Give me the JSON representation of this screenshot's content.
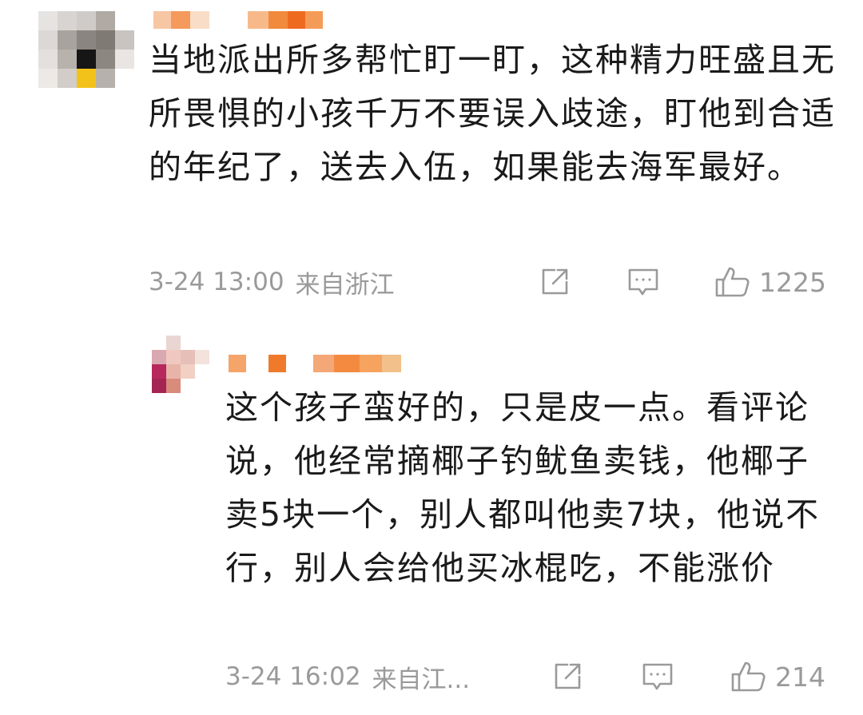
{
  "comment": {
    "text": "当地派出所多帮忙盯一盯，这种精力旺盛且无所畏惧的小孩千万不要误入歧途，盯他到合适的年纪了，送去入伍，如果能去海军最好。",
    "time": "3-24 13:00",
    "location": "来自浙江",
    "likes": "1225",
    "icons": {
      "share": "share-icon",
      "comment": "comment-icon",
      "like": "thumbs-up-icon"
    },
    "avatar_colors": [
      "#e6e4e3",
      "#d7d4d2",
      "#cfcbc8",
      "#b0aaa5",
      "#ffffff",
      "#dcd8d5",
      "#a9a39d",
      "#8a8580",
      "#7f7a74",
      "#c9c4bf",
      "#e3e0dd",
      "#b8b2ac",
      "#161616",
      "#8d8782",
      "#e8e5e2",
      "#ece9e6",
      "#d2cdc8",
      "#f2c21a",
      "#b7b1ab",
      "#ffffff"
    ],
    "username_colors": [
      "#f7c6a3",
      "#f39a5c",
      "#f9ddc6",
      "#ffffff",
      "#f8b98a",
      "#f28a3d",
      "#ee6a1f",
      "#f59b58"
    ]
  },
  "reply": {
    "text": "这个孩子蛮好的，只是皮一点。看评论说，他经常摘椰子钓鱿鱼卖钱，他椰子卖5块一个，别人都叫他卖7块，他说不行，别人会给他买冰棍吃，不能涨价",
    "time": "3-24 16:02",
    "location": "来自江...",
    "likes": "214",
    "icons": {
      "share": "share-icon",
      "comment": "comment-icon",
      "like": "thumbs-up-icon"
    },
    "avatar_colors": [
      "#ffffff",
      "#e9d6d3",
      "#ffffff",
      "#ffffff",
      "#d9a8b0",
      "#f0c8c0",
      "#e6c0b8",
      "#f3e3dc",
      "#b7285c",
      "#e8b4a8",
      "#f2d0c4",
      "#ffffff",
      "#a52552",
      "#d98b7c",
      "#ffffff",
      "#ffffff"
    ],
    "username_colors": [
      "#f5a46a",
      "#ffffff",
      "#f07a2c",
      "#ffffff",
      "#f4a877",
      "#f38a40",
      "#f6a35f",
      "#f2c08a"
    ]
  }
}
